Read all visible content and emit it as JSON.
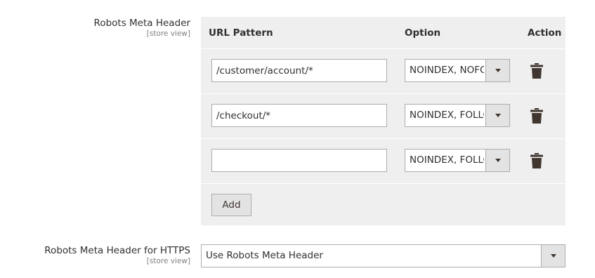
{
  "robots_meta_header": {
    "label": "Robots Meta Header",
    "scope": "[store view]",
    "columns": {
      "url_pattern": "URL Pattern",
      "option": "Option",
      "action": "Action"
    },
    "rows": [
      {
        "url_pattern": "/customer/account/*",
        "option": "NOINDEX, NOFOLLOW"
      },
      {
        "url_pattern": "/checkout/*",
        "option": "NOINDEX, FOLLOW"
      },
      {
        "url_pattern": "",
        "option": "NOINDEX, FOLLOW"
      }
    ],
    "add_label": "Add"
  },
  "robots_meta_header_https": {
    "label": "Robots Meta Header for HTTPS",
    "scope": "[store view]",
    "value": "Use Robots Meta Header"
  },
  "icons": {
    "delete": "trash-icon",
    "dropdown": "caret-down-icon"
  }
}
